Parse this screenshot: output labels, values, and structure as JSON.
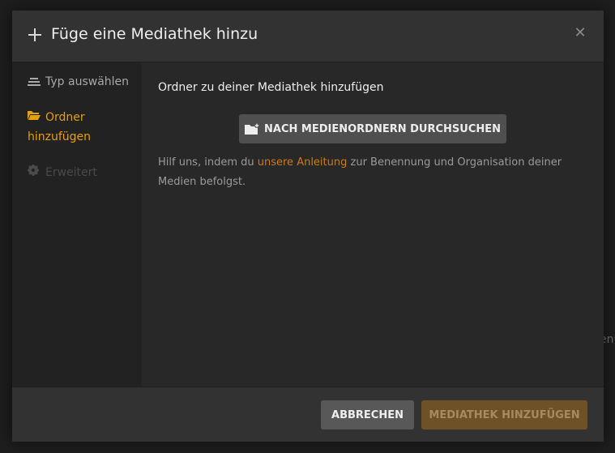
{
  "background": {
    "partial_text": "en"
  },
  "dialog": {
    "title": "Füge eine Mediathek hinzu"
  },
  "sidebar": {
    "items": [
      {
        "label": "Typ auswählen",
        "state": "completed",
        "icon": "list-icon"
      },
      {
        "label": "Ordner hinzufügen",
        "state": "active",
        "icon": "folder-open-icon"
      },
      {
        "label": "Erweitert",
        "state": "disabled",
        "icon": "gear-icon"
      }
    ]
  },
  "content": {
    "heading": "Ordner zu deiner Mediathek hinzufügen",
    "browse_button": "NACH MEDIENORDNERN DURCHSUCHEN",
    "help_prefix": "Hilf uns, indem du ",
    "help_link": "unsere Anleitung",
    "help_suffix": " zur Benennung und Organisation deiner Medien befolgst."
  },
  "footer": {
    "cancel_label": "ABBRECHEN",
    "add_label": "MEDIATHEK HINZUFÜGEN"
  },
  "colors": {
    "accent": "#e5a00d",
    "link": "#cc7b19",
    "add_button_disabled": "#6e5126"
  }
}
